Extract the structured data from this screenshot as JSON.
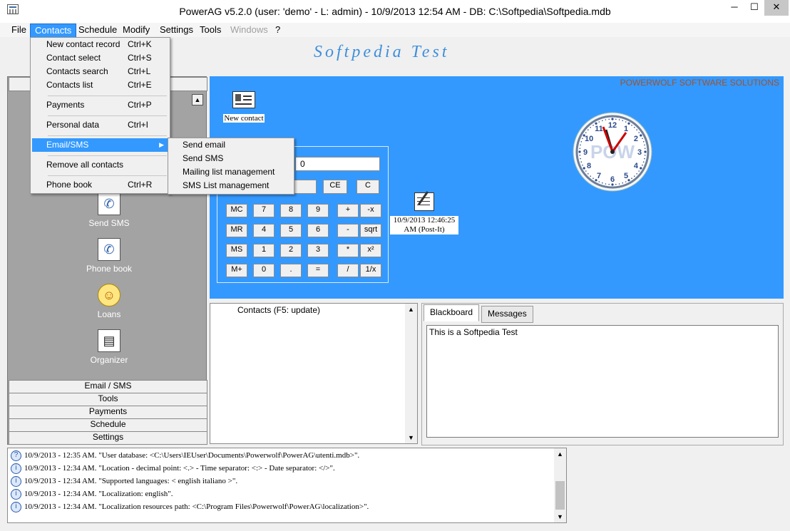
{
  "window": {
    "title": "PowerAG v5.2.0  (user: 'demo'  - L: admin) - 10/9/2013 12:54 AM - DB: C:\\Softpedia\\Softpedia.mdb",
    "minimize": "─",
    "maximize": "☐",
    "close": "✕"
  },
  "menubar": [
    "File",
    "Contacts",
    "Schedule",
    "Modify",
    "Settings",
    "Tools",
    "Windows",
    "?"
  ],
  "banner": "Softpedia Test",
  "contacts_menu": [
    {
      "label": "New contact record",
      "shortcut": "Ctrl+K"
    },
    {
      "label": "Contact select",
      "shortcut": "Ctrl+S"
    },
    {
      "label": "Contacts search",
      "shortcut": "Ctrl+L"
    },
    {
      "label": "Contacts list",
      "shortcut": "Ctrl+E"
    },
    {
      "label": "Payments",
      "shortcut": "Ctrl+P"
    },
    {
      "label": "Personal data",
      "shortcut": "Ctrl+I"
    },
    {
      "label": "Email/SMS",
      "shortcut": ""
    },
    {
      "label": "Remove all contacts",
      "shortcut": ""
    },
    {
      "label": "Phone book",
      "shortcut": "Ctrl+R"
    }
  ],
  "email_submenu": [
    "Send email",
    "Send SMS",
    "Mailing list management",
    "SMS List management"
  ],
  "left_panel": {
    "items": [
      "Send SMS",
      "Phone book",
      "Loans",
      "Organizer"
    ],
    "sections": [
      "Email / SMS",
      "Tools",
      "Payments",
      "Schedule",
      "Settings"
    ]
  },
  "desktop": {
    "company": "POWERWOLF SOFTWARE SOLUTIONS",
    "new_contact": "New contact",
    "postit": "10/9/2013 12:46:25 AM (Post-It)",
    "clock_logo": "POW"
  },
  "calculator": {
    "display": "0",
    "top_row": [
      "CE",
      "C"
    ],
    "rows": [
      [
        "MC",
        "7",
        "8",
        "9",
        "+",
        "-x"
      ],
      [
        "MR",
        "4",
        "5",
        "6",
        "-",
        "sqrt"
      ],
      [
        "MS",
        "1",
        "2",
        "3",
        "*",
        "x²"
      ],
      [
        "M+",
        "0",
        ".",
        "=",
        "/",
        "1/x"
      ]
    ]
  },
  "contacts_panel": {
    "header": "Contacts  (F5: update)"
  },
  "blackboard": {
    "tabs": [
      "Blackboard",
      "Messages"
    ],
    "text": "This is a Softpedia Test"
  },
  "log": [
    "10/9/2013 - 12:35 AM. \"User database: <C:\\Users\\IEUser\\Documents\\Powerwolf\\PowerAG\\utenti.mdb>\".",
    "10/9/2013 - 12:34 AM. \"Location - decimal point: <.> - Time separator: <:> - Date separator: </>\".",
    "10/9/2013 - 12:34 AM. \"Supported languages: < english italiano >\".",
    "10/9/2013 - 12:34 AM. \"Localization: english\".",
    "10/9/2013 - 12:34 AM. \"Localization resources path: <C:\\Program Files\\Powerwolf\\PowerAG\\localization>\"."
  ],
  "colors": {
    "accent": "#3399ff",
    "banner_text": "#3f8fdc",
    "company_text": "#a0522d"
  }
}
